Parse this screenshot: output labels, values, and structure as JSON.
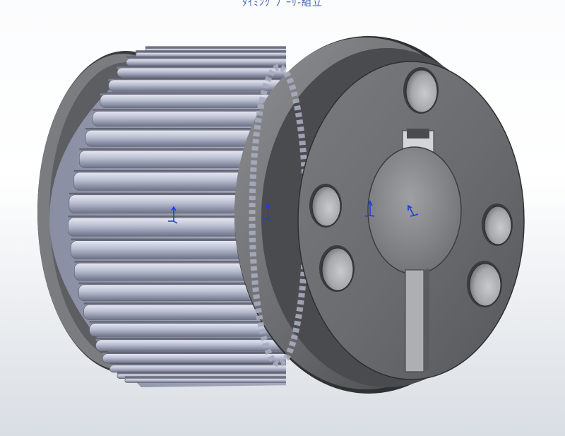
{
  "viewport": {
    "title_text": "ﾀｲﾐﾝｸﾞﾌﾟｰﾘ-組立",
    "background_top": "#fbfcfd",
    "background_bottom": "#d9dee4"
  },
  "model": {
    "name": "timing-pulley",
    "tooth_count": 22,
    "mounting_hole_count": 5,
    "body_color": "#6d6e71",
    "teeth_color": "#b6bccd",
    "triad_color": "#1f3fd6"
  }
}
